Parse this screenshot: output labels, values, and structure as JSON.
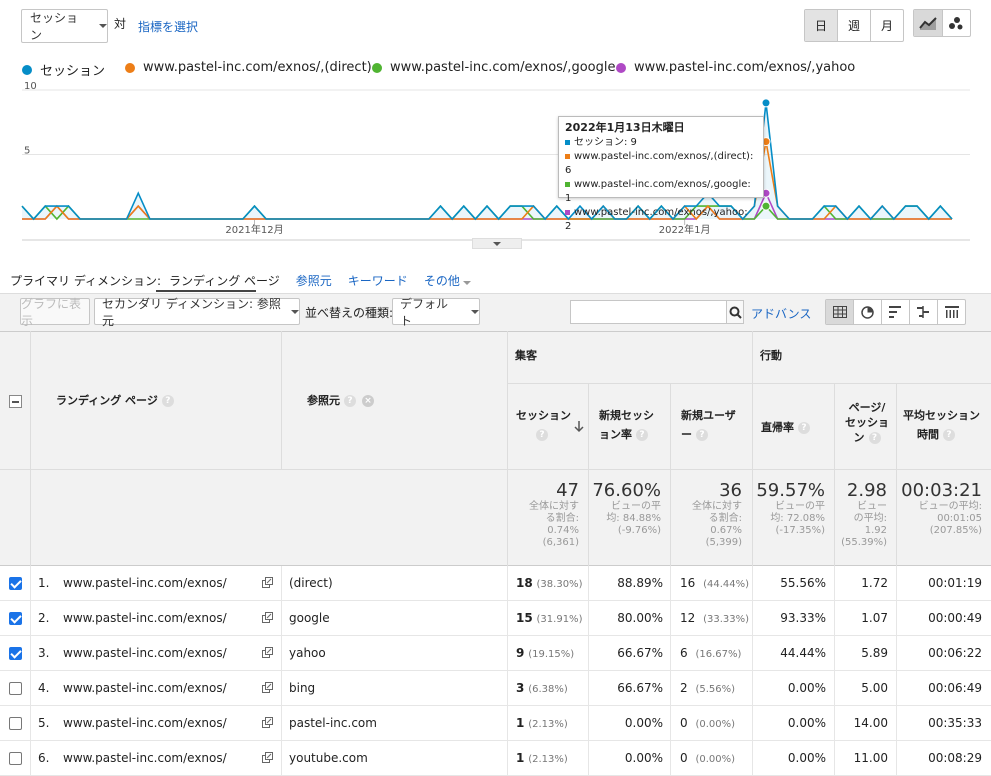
{
  "toolbar": {
    "metric_select": "セッション",
    "vs_label": "対",
    "select_metric_link": "指標を選択",
    "day": "日",
    "week": "週",
    "month": "月"
  },
  "legend": [
    {
      "label": "セッション",
      "color": "#058dc7"
    },
    {
      "label": "www.pastel-inc.com/exnos/,(direct)",
      "color": "#ed7e17"
    },
    {
      "label": "www.pastel-inc.com/exnos/,google",
      "color": "#50b432"
    },
    {
      "label": "www.pastel-inc.com/exnos/,yahoo",
      "color": "#af49c5"
    }
  ],
  "chart_data": {
    "type": "line",
    "y_ticks": [
      "10",
      "5"
    ],
    "ylim": [
      0,
      10
    ],
    "x_ticks": [
      "2021年12月",
      "2022年1月"
    ],
    "series": [
      {
        "name": "セッション",
        "color": "#058dc7",
        "values": [
          1,
          0,
          1,
          1,
          1,
          0,
          0,
          0,
          0,
          0,
          2,
          0,
          0,
          0,
          0,
          0,
          0,
          0,
          0,
          0,
          1,
          0,
          0,
          0,
          0,
          0,
          0,
          0,
          0,
          0,
          0,
          0,
          0,
          0,
          0,
          0,
          1,
          0,
          1,
          0,
          1,
          0,
          1,
          1,
          1,
          0,
          1,
          0,
          1,
          0,
          1,
          0,
          0,
          1,
          0,
          1,
          0,
          1,
          1,
          2,
          1,
          1,
          0,
          1,
          9,
          1,
          0,
          0,
          0,
          1,
          1,
          0,
          1,
          0,
          1,
          0,
          1,
          1,
          0,
          1,
          0
        ]
      },
      {
        "name": "www.pastel-inc.com/exnos/,(direct)",
        "color": "#ed7e17",
        "values": [
          0,
          0,
          0,
          1,
          0,
          0,
          0,
          0,
          0,
          0,
          1,
          0,
          0,
          0,
          0,
          0,
          0,
          0,
          0,
          0,
          0,
          0,
          0,
          0,
          0,
          0,
          0,
          0,
          0,
          0,
          0,
          0,
          0,
          0,
          0,
          0,
          0,
          0,
          0,
          0,
          0,
          0,
          0,
          0,
          1,
          0,
          0,
          0,
          0,
          0,
          1,
          0,
          0,
          0,
          0,
          0,
          0,
          1,
          0,
          1,
          0,
          0,
          0,
          1,
          6,
          1,
          0,
          0,
          0,
          0,
          1,
          0,
          0,
          0,
          1,
          0,
          0,
          0,
          0,
          0,
          0
        ]
      },
      {
        "name": "www.pastel-inc.com/exnos/,google",
        "color": "#50b432",
        "values": [
          1,
          0,
          1,
          0,
          1,
          0,
          0,
          0,
          0,
          0,
          0,
          0,
          0,
          0,
          0,
          0,
          0,
          0,
          0,
          0,
          1,
          0,
          0,
          0,
          0,
          0,
          0,
          0,
          0,
          0,
          0,
          0,
          0,
          0,
          0,
          0,
          1,
          0,
          1,
          0,
          1,
          0,
          1,
          1,
          0,
          0,
          1,
          0,
          0,
          0,
          0,
          0,
          0,
          1,
          0,
          1,
          0,
          0,
          1,
          1,
          1,
          1,
          0,
          0,
          1,
          0,
          0,
          0,
          0,
          1,
          0,
          0,
          1,
          0,
          0,
          0,
          1,
          1,
          0,
          1,
          0
        ]
      },
      {
        "name": "www.pastel-inc.com/exnos/,yahoo",
        "color": "#af49c5",
        "values": [
          0,
          0,
          0,
          1,
          0,
          0,
          0,
          0,
          0,
          0,
          1,
          0,
          0,
          0,
          0,
          0,
          0,
          0,
          0,
          0,
          0,
          0,
          0,
          0,
          0,
          0,
          0,
          0,
          0,
          0,
          0,
          0,
          0,
          0,
          0,
          0,
          0,
          0,
          0,
          0,
          0,
          0,
          0,
          0,
          0,
          0,
          0,
          0,
          0,
          0,
          0,
          0,
          0,
          0,
          0,
          0,
          0,
          0,
          0,
          1,
          0,
          0,
          0,
          0,
          2,
          0,
          0,
          0,
          0,
          0,
          0,
          0,
          0,
          0,
          0,
          0,
          0,
          0,
          0,
          0,
          0
        ]
      }
    ],
    "highlight_index": 64,
    "tooltip": {
      "date": "2022年1月13日木曜日",
      "lines": [
        {
          "label": "セッション: 9",
          "color": "#058dc7"
        },
        {
          "label": "www.pastel-inc.com/exnos/,(direct): 6",
          "color": "#ed7e17"
        },
        {
          "label": "www.pastel-inc.com/exnos/,google: 1",
          "color": "#50b432"
        },
        {
          "label": "www.pastel-inc.com/exnos/,yahoo: 2",
          "color": "#af49c5"
        }
      ]
    }
  },
  "dimensions": {
    "primary_label": "プライマリ ディメンション:",
    "landing_page": "ランディング ページ",
    "referrer": "参照元",
    "keyword": "キーワード",
    "other": "その他"
  },
  "table_toolbar": {
    "plot_rows": "グラフに表示",
    "secondary_dim": "セカンダリ ディメンション: 参照元",
    "sort_label": "並べ替えの種類:",
    "sort_value": "デフォルト",
    "search_placeholder": "",
    "advanced": "アドバンス"
  },
  "table": {
    "group_acquisition": "集客",
    "group_behavior": "行動",
    "headers": {
      "landing": "ランディング ページ",
      "referrer": "参照元",
      "sessions": "セッション",
      "new_sessions_a": "新規セッシ",
      "new_sessions_b": "ョン率",
      "new_users_a": "新規ユーザ",
      "new_users_b": "ー",
      "bounce": "直帰率",
      "pages_a": "ページ/",
      "pages_b": "セッショ",
      "pages_c": "ン",
      "avg_a": "平均セッション",
      "avg_b": "時間"
    },
    "totals": {
      "sessions": "47",
      "sessions_sub": [
        "全体に対す",
        "る割合:",
        "0.74%",
        "(6,361)"
      ],
      "new_sessions": "76.60%",
      "new_sessions_sub": [
        "ビューの平",
        "均: 84.88%",
        "(-9.76%)"
      ],
      "new_users": "36",
      "new_users_sub": [
        "全体に対す",
        "る割合:",
        "0.67%",
        "(5,399)"
      ],
      "bounce": "59.57%",
      "bounce_sub": [
        "ビューの平",
        "均: 72.08%",
        "(-17.35%)"
      ],
      "pages": "2.98",
      "pages_sub": [
        "ビュー",
        "の平均:",
        "1.92",
        "(55.39%)"
      ],
      "avg": "00:03:21",
      "avg_sub": [
        "ビューの平均:",
        "00:01:05",
        "(207.85%)"
      ]
    },
    "rows": [
      {
        "checked": true,
        "num": "1.",
        "page": "www.pastel-inc.com/exnos/",
        "ref": "(direct)",
        "sessions": "18",
        "sessions_pct": "(38.30%)",
        "new_sessions": "88.89%",
        "new_users": "16",
        "new_users_pct": "(44.44%)",
        "bounce": "55.56%",
        "pages": "1.72",
        "avg": "00:01:19"
      },
      {
        "checked": true,
        "num": "2.",
        "page": "www.pastel-inc.com/exnos/",
        "ref": "google",
        "sessions": "15",
        "sessions_pct": "(31.91%)",
        "new_sessions": "80.00%",
        "new_users": "12",
        "new_users_pct": "(33.33%)",
        "bounce": "93.33%",
        "pages": "1.07",
        "avg": "00:00:49"
      },
      {
        "checked": true,
        "num": "3.",
        "page": "www.pastel-inc.com/exnos/",
        "ref": "yahoo",
        "sessions": "9",
        "sessions_pct": "(19.15%)",
        "new_sessions": "66.67%",
        "new_users": "6",
        "new_users_pct": "(16.67%)",
        "bounce": "44.44%",
        "pages": "5.89",
        "avg": "00:06:22"
      },
      {
        "checked": false,
        "num": "4.",
        "page": "www.pastel-inc.com/exnos/",
        "ref": "bing",
        "sessions": "3",
        "sessions_pct": "(6.38%)",
        "new_sessions": "66.67%",
        "new_users": "2",
        "new_users_pct": "(5.56%)",
        "bounce": "0.00%",
        "pages": "5.00",
        "avg": "00:06:49"
      },
      {
        "checked": false,
        "num": "5.",
        "page": "www.pastel-inc.com/exnos/",
        "ref": "pastel-inc.com",
        "sessions": "1",
        "sessions_pct": "(2.13%)",
        "new_sessions": "0.00%",
        "new_users": "0",
        "new_users_pct": "(0.00%)",
        "bounce": "0.00%",
        "pages": "14.00",
        "avg": "00:35:33"
      },
      {
        "checked": false,
        "num": "6.",
        "page": "www.pastel-inc.com/exnos/",
        "ref": "youtube.com",
        "sessions": "1",
        "sessions_pct": "(2.13%)",
        "new_sessions": "0.00%",
        "new_users": "0",
        "new_users_pct": "(0.00%)",
        "bounce": "0.00%",
        "pages": "11.00",
        "avg": "00:08:29"
      }
    ]
  }
}
